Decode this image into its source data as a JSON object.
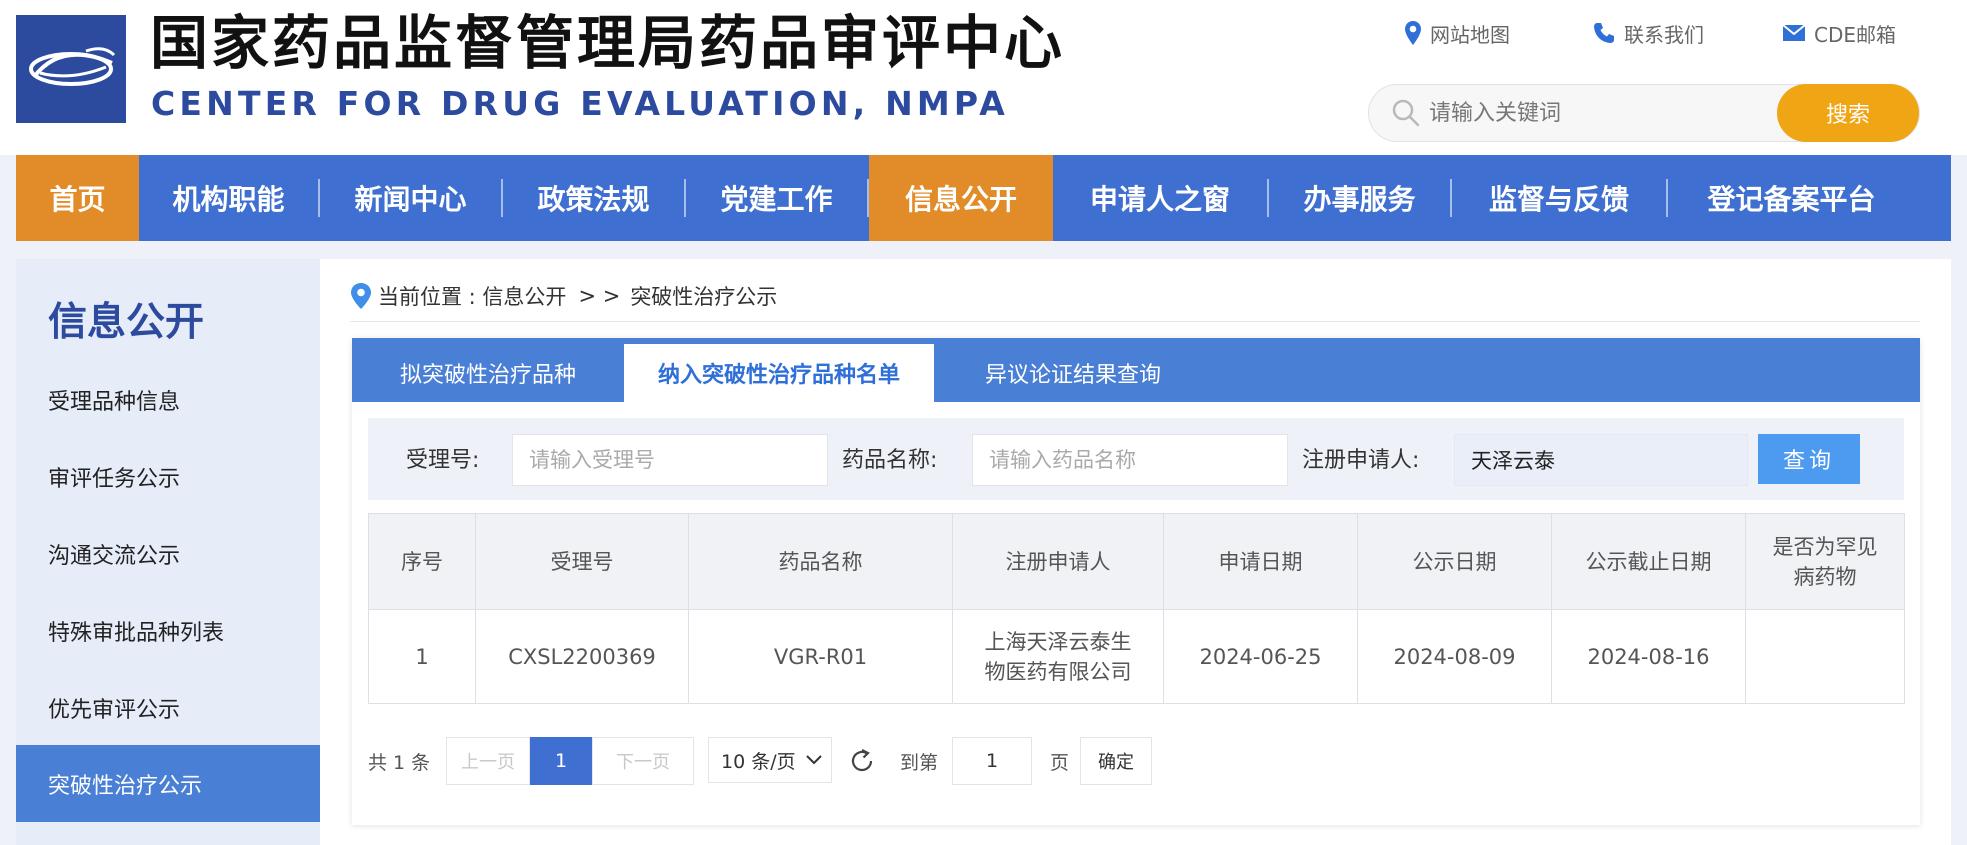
{
  "header": {
    "title": "国家药品监督管理局药品审评中心",
    "subtitle": "CENTER FOR DRUG EVALUATION, NMPA",
    "links": {
      "sitemap": "网站地图",
      "contact": "联系我们",
      "mail": "CDE邮箱"
    },
    "search": {
      "placeholder": "请输入关键词",
      "button": "搜索"
    }
  },
  "nav": {
    "items": [
      "首页",
      "机构职能",
      "新闻中心",
      "政策法规",
      "党建工作",
      "信息公开",
      "申请人之窗",
      "办事服务",
      "监督与反馈",
      "登记备案平台"
    ],
    "active": [
      "首页",
      "信息公开"
    ]
  },
  "sidebar": {
    "title": "信息公开",
    "items": [
      "受理品种信息",
      "审评任务公示",
      "沟通交流公示",
      "特殊审批品种列表",
      "优先审评公示",
      "突破性治疗公示"
    ],
    "active": "突破性治疗公示"
  },
  "breadcrumb": {
    "prefix": "当前位置 : 信息公开",
    "separator": "> >",
    "current": "突破性治疗公示"
  },
  "tabs": {
    "items": [
      "拟突破性治疗品种",
      "纳入突破性治疗品种名单",
      "异议论证结果查询"
    ],
    "active": "纳入突破性治疗品种名单"
  },
  "filter": {
    "accept_no_label": "受理号:",
    "accept_no_placeholder": "请输入受理号",
    "drug_name_label": "药品名称:",
    "drug_name_placeholder": "请输入药品名称",
    "applicant_label": "注册申请人:",
    "applicant_value": "天泽云泰",
    "query_button": "查询"
  },
  "table": {
    "headers": [
      "序号",
      "受理号",
      "药品名称",
      "注册申请人",
      "申请日期",
      "公示日期",
      "公示截止日期",
      "是否为罕见病药物"
    ],
    "rows": [
      [
        "1",
        "CXSL2200369",
        "VGR-R01",
        "上海天泽云泰生物医药有限公司",
        "2024-06-25",
        "2024-08-09",
        "2024-08-16",
        ""
      ]
    ]
  },
  "pagination": {
    "total": "共 1 条",
    "prev": "上一页",
    "current": "1",
    "next": "下一页",
    "page_size": "10 条/页",
    "goto_label": "到第",
    "goto_value": "1",
    "page_unit": "页",
    "confirm": "确定"
  },
  "colors": {
    "brand_blue": "#2c4a9e",
    "nav_blue": "#3f6fd0",
    "nav_active": "#e28b29",
    "search_button": "#f0a514",
    "tab_blue": "#4a7fd6",
    "query_button": "#4c9bf0"
  },
  "icons": {
    "sitemap": "location-pin-icon",
    "contact": "phone-icon",
    "mail": "mail-icon",
    "search": "search-icon",
    "breadcrumb": "location-pin-icon",
    "refresh": "refresh-icon",
    "page_size": "chevron-down-icon"
  }
}
